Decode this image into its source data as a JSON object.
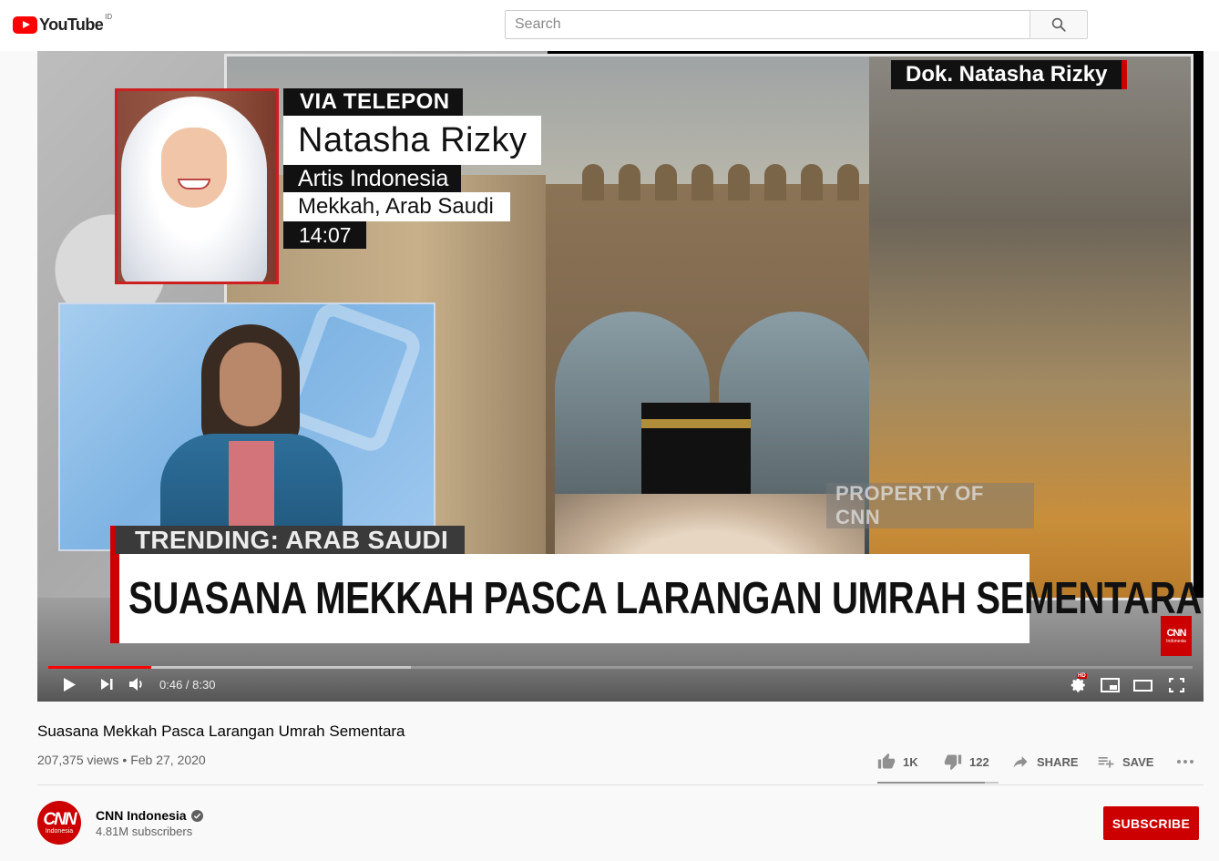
{
  "header": {
    "logo_text": "YouTube",
    "country_code": "ID",
    "search_placeholder": "Search"
  },
  "player": {
    "frame": {
      "credit": "Dok. Natasha Rizky",
      "via": "VIA TELEPON",
      "caller_name": "Natasha Rizky",
      "caller_role": "Artis Indonesia",
      "caller_location": "Mekkah, Arab Saudi",
      "clock": "14:07",
      "watermark": "PROPERTY OF CNN",
      "trending": "TRENDING: ARAB SAUDI",
      "headline": "SUASANA MEKKAH PASCA LARANGAN UMRAH SEMENTARA",
      "bug_brand": "CNN",
      "bug_sub": "Indonesia"
    },
    "time_current": "0:46",
    "time_total": "8:30",
    "time_separator": " / ",
    "progress_played_fraction": 0.0902,
    "progress_loaded_fraction": 0.317,
    "hd_label": "HD"
  },
  "video": {
    "title": "Suasana Mekkah Pasca Larangan Umrah Sementara",
    "views": "207,375 views",
    "date": "Feb 27, 2020",
    "meta_separator": " • ",
    "likes": "1K",
    "dislikes": "122",
    "share_label": "SHARE",
    "save_label": "SAVE",
    "like_fraction": 0.89
  },
  "channel": {
    "name": "CNN Indonesia",
    "subscribers": "4.81M subscribers",
    "avatar_brand": "CNN",
    "avatar_sub": "Indonesia",
    "subscribe_label": "SUBSCRIBE"
  },
  "colors": {
    "brand_red": "#cc0000",
    "progress_red": "#ff0000"
  }
}
